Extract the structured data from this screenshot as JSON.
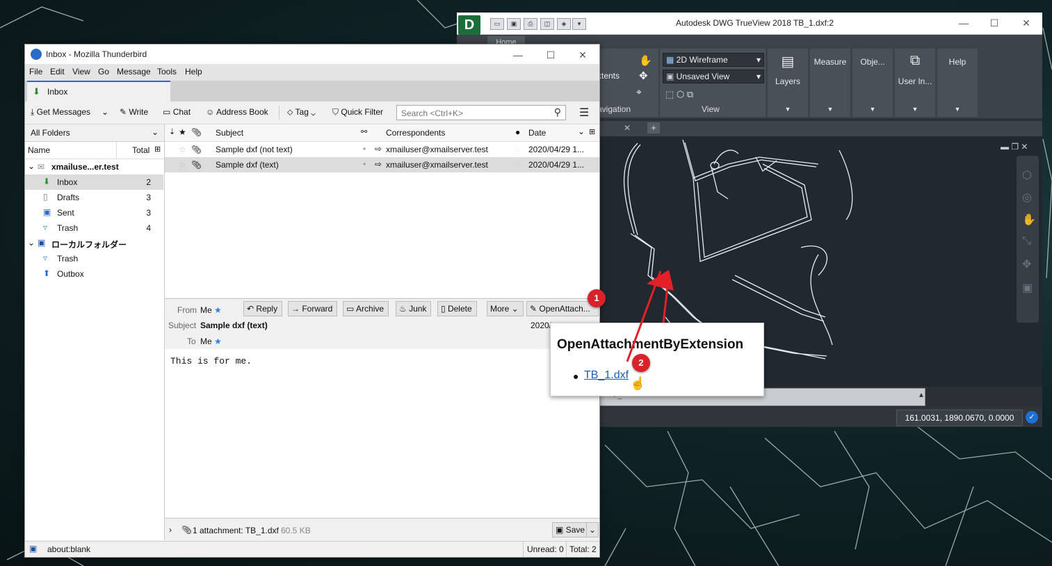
{
  "dwg": {
    "logo": "D",
    "title": "Autodesk DWG TrueView 2018    TB_1.dxf:2",
    "home_tab": "Home",
    "extents_label": "xtents",
    "view_style": "2D Wireframe",
    "saved_view": "Unsaved View",
    "panels": [
      "Layers",
      "Measure",
      "Obje...",
      "User In...",
      "Help"
    ],
    "navigation_label": "avigation",
    "view_label": "View",
    "coords": "161.0031, 1890.0670, 0.0000"
  },
  "tb": {
    "title": "Inbox - Mozilla Thunderbird",
    "menu": [
      "File",
      "Edit",
      "View",
      "Go",
      "Message",
      "Tools",
      "Help"
    ],
    "tab": "Inbox",
    "toolbar": {
      "get_messages": "Get Messages",
      "write": "Write",
      "chat": "Chat",
      "address_book": "Address Book",
      "tag": "Tag",
      "quick_filter": "Quick Filter",
      "search_placeholder": "Search <Ctrl+K>"
    },
    "sidebar": {
      "folder_select": "All Folders",
      "col_name": "Name",
      "col_total": "Total",
      "account": "xmailuse...er.test",
      "folders": [
        {
          "name": "Inbox",
          "count": "2"
        },
        {
          "name": "Drafts",
          "count": "3"
        },
        {
          "name": "Sent",
          "count": "3"
        },
        {
          "name": "Trash",
          "count": "4"
        }
      ],
      "local": "ローカルフォルダー",
      "local_folders": [
        {
          "name": "Trash"
        },
        {
          "name": "Outbox"
        }
      ]
    },
    "thread": {
      "col_subject": "Subject",
      "col_correspondents": "Correspondents",
      "col_date": "Date",
      "rows": [
        {
          "subject": "Sample dxf (not text)",
          "correspondent": "xmailuser@xmailserver.test",
          "date": "2020/04/29 1..."
        },
        {
          "subject": "Sample dxf (text)",
          "correspondent": "xmailuser@xmailserver.test",
          "date": "2020/04/29 1..."
        }
      ]
    },
    "header": {
      "from_label": "From",
      "from_value": "Me",
      "subject_label": "Subject",
      "subject_value": "Sample dxf (text)",
      "to_label": "To",
      "to_value": "Me",
      "date": "2020/",
      "buttons": {
        "reply": "Reply",
        "forward": "Forward",
        "archive": "Archive",
        "junk": "Junk",
        "delete": "Delete",
        "more": "More",
        "open_attach": "OpenAttach..."
      }
    },
    "body": "This is for me.",
    "attachment": {
      "summary": "1 attachment: TB_1.dxf",
      "size": "60.5 KB",
      "save": "Save"
    },
    "status": {
      "url": "about:blank",
      "unread": "Unread: 0",
      "total": "Total: 2"
    }
  },
  "popup": {
    "title": "OpenAttachmentByExtension",
    "link": "TB_1.dxf"
  },
  "badges": [
    "1",
    "2"
  ]
}
